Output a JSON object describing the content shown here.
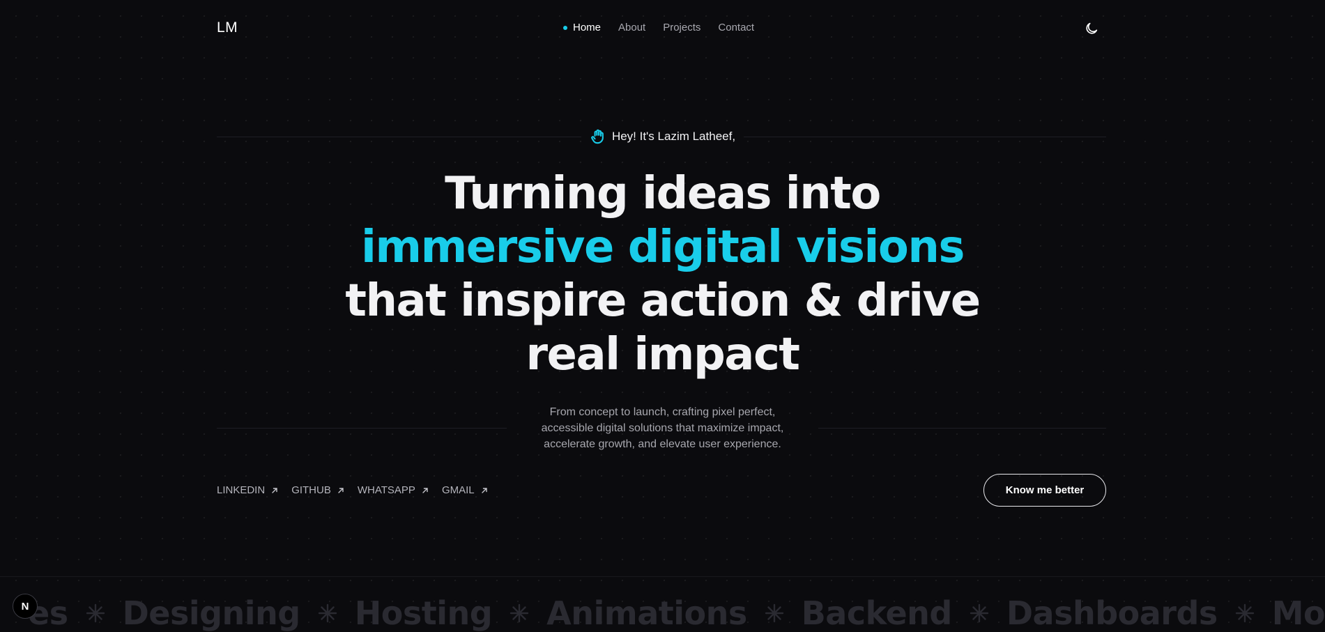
{
  "header": {
    "logo": "LM",
    "nav": [
      {
        "label": "Home",
        "active": true
      },
      {
        "label": "About",
        "active": false
      },
      {
        "label": "Projects",
        "active": false
      },
      {
        "label": "Contact",
        "active": false
      }
    ],
    "theme_icon": "moon-icon"
  },
  "hero": {
    "greeting": "Hey! It's Lazim Latheef,",
    "greeting_icon": "waving-hand-icon",
    "headline_line1": "Turning ideas into",
    "headline_line2": "immersive digital visions",
    "headline_line3": "that inspire action & drive",
    "headline_line4": "real impact",
    "description_line1": "From concept to launch, crafting pixel perfect,",
    "description_line2": "accessible digital solutions that maximize impact,",
    "description_line3": "accelerate growth, and elevate user experience."
  },
  "socials": [
    {
      "label": "LINKEDIN",
      "icon": "arrow-up-right-icon"
    },
    {
      "label": "GITHUB",
      "icon": "arrow-up-right-icon"
    },
    {
      "label": "WHATSAPP",
      "icon": "arrow-up-right-icon"
    },
    {
      "label": "GMAIL",
      "icon": "arrow-up-right-icon"
    }
  ],
  "cta": {
    "label": "Know me better"
  },
  "marquee": {
    "words": [
      "es",
      "Designing",
      "Hosting",
      "Animations",
      "Backend",
      "Dashboards",
      "Mo"
    ],
    "separator_icon": "asterisk-icon"
  },
  "badge": {
    "label": "N"
  },
  "colors": {
    "background": "#0b0b0e",
    "accent": "#19cdea",
    "text": "#f2f2f4",
    "muted": "#a7a7ae"
  }
}
